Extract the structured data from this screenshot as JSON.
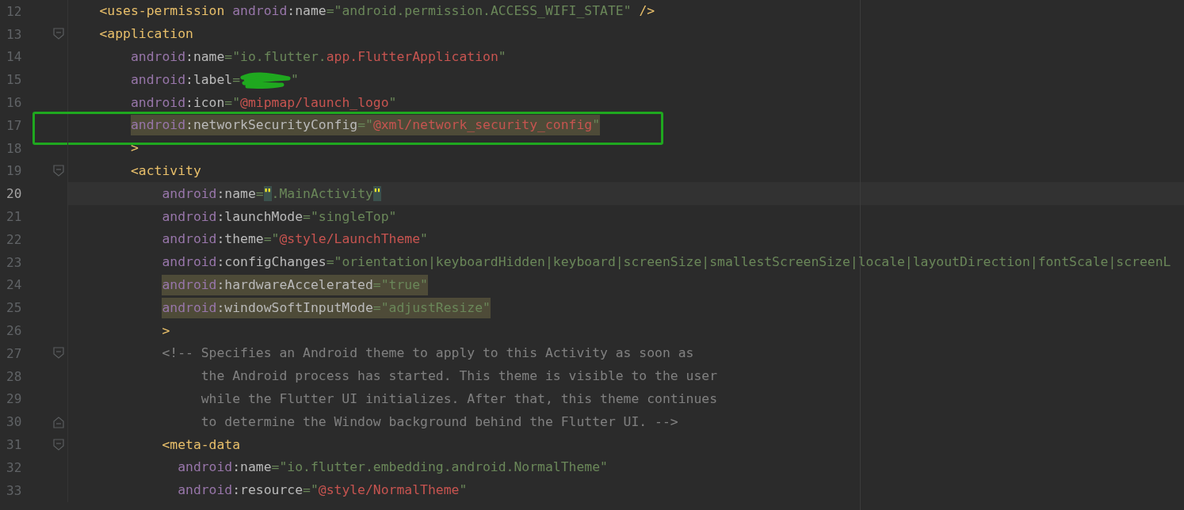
{
  "editor": {
    "lines": [
      {
        "number": "12",
        "tokens": [
          {
            "kind": "tag",
            "text": "<uses-permission"
          },
          {
            "kind": "ns",
            "text": " android"
          },
          {
            "kind": "attr",
            "text": ":name"
          },
          {
            "kind": "string",
            "text": "=\"android.permission.ACCESS_WIFI_STATE\""
          },
          {
            "kind": "tag",
            "text": " />"
          }
        ]
      },
      {
        "number": "13",
        "kind": "block",
        "fold_start": true,
        "tokens": [
          {
            "kind": "tag",
            "text": "<application"
          }
        ],
        "children": [
          {
            "number": "14",
            "tokens": [
              {
                "kind": "ns",
                "text": "android"
              },
              {
                "kind": "attr",
                "text": ":name"
              },
              {
                "kind": "string",
                "text": "=\"io.flutter."
              },
              {
                "kind": "ref",
                "text": "app.FlutterApplication"
              },
              {
                "kind": "string",
                "text": "\""
              }
            ]
          },
          {
            "number": "15",
            "tokens": [
              {
                "kind": "ns",
                "text": "android"
              },
              {
                "kind": "attr",
                "text": ":label"
              },
              {
                "kind": "string",
                "text": "="
              },
              {
                "kind": "scribble"
              },
              {
                "kind": "string",
                "text": "\""
              }
            ]
          },
          {
            "number": "16",
            "tokens": [
              {
                "kind": "ns",
                "text": "android"
              },
              {
                "kind": "attr",
                "text": ":icon"
              },
              {
                "kind": "string",
                "text": "=\""
              },
              {
                "kind": "ref",
                "text": "@mipmap/launch_logo"
              },
              {
                "kind": "string",
                "text": "\""
              }
            ]
          },
          {
            "number": "17",
            "highlighted": true,
            "annotated": true,
            "tokens": [
              {
                "kind": "ns",
                "text": "android"
              },
              {
                "kind": "attr",
                "text": ":networkSecurityConfig"
              },
              {
                "kind": "string",
                "text": "=\""
              },
              {
                "kind": "ref",
                "text": "@xml/network_security_config"
              },
              {
                "kind": "string",
                "text": "\""
              }
            ]
          },
          {
            "number": "18",
            "tokens": [
              {
                "kind": "tag",
                "text": ">"
              }
            ]
          },
          {
            "number": "19",
            "kind": "block",
            "fold_start": true,
            "tokens": [
              {
                "kind": "tag",
                "text": "<activity"
              }
            ],
            "children": [
              {
                "number": "20",
                "current": true,
                "tokens": [
                  {
                    "kind": "ns",
                    "text": "android"
                  },
                  {
                    "kind": "attr",
                    "text": ":name"
                  },
                  {
                    "kind": "string",
                    "text": "="
                  },
                  {
                    "kind": "match",
                    "text": "\""
                  },
                  {
                    "kind": "string",
                    "text": ".MainActivity"
                  },
                  {
                    "kind": "match",
                    "text": "\""
                  }
                ]
              },
              {
                "number": "21",
                "tokens": [
                  {
                    "kind": "ns",
                    "text": "android"
                  },
                  {
                    "kind": "attr",
                    "text": ":launchMode"
                  },
                  {
                    "kind": "string",
                    "text": "=\"singleTop\""
                  }
                ]
              },
              {
                "number": "22",
                "tokens": [
                  {
                    "kind": "ns",
                    "text": "android"
                  },
                  {
                    "kind": "attr",
                    "text": ":theme"
                  },
                  {
                    "kind": "string",
                    "text": "=\""
                  },
                  {
                    "kind": "ref",
                    "text": "@style/LaunchTheme"
                  },
                  {
                    "kind": "string",
                    "text": "\""
                  }
                ]
              },
              {
                "number": "23",
                "tokens": [
                  {
                    "kind": "ns",
                    "text": "android"
                  },
                  {
                    "kind": "attr",
                    "text": ":configChanges"
                  },
                  {
                    "kind": "string",
                    "text": "=\"orientation|keyboardHidden|keyboard|screenSize|smallestScreenSize|locale|layoutDirection|fontScale|screenL"
                  }
                ]
              },
              {
                "number": "24",
                "highlighted": true,
                "tokens": [
                  {
                    "kind": "ns",
                    "text": "android"
                  },
                  {
                    "kind": "attr",
                    "text": ":hardwareAccelerated"
                  },
                  {
                    "kind": "string",
                    "text": "=\"true\""
                  }
                ]
              },
              {
                "number": "25",
                "highlighted": true,
                "tokens": [
                  {
                    "kind": "ns",
                    "text": "android"
                  },
                  {
                    "kind": "attr",
                    "text": ":windowSoftInputMode"
                  },
                  {
                    "kind": "string",
                    "text": "=\"adjustResize\""
                  }
                ]
              },
              {
                "number": "26",
                "tokens": [
                  {
                    "kind": "tag",
                    "text": ">"
                  }
                ]
              },
              {
                "number": "27",
                "kind": "comment",
                "fold_start": true,
                "tokens": [
                  {
                    "kind": "comment",
                    "text": "<!-- Specifies an Android theme to apply to this Activity as soon as"
                  }
                ],
                "children": [
                  {
                    "number": "28",
                    "tokens": [
                      {
                        "kind": "comment",
                        "text": "the Android process has started. This theme is visible to the user"
                      }
                    ]
                  },
                  {
                    "number": "29",
                    "tokens": [
                      {
                        "kind": "comment",
                        "text": "while the Flutter UI initializes. After that, this theme continues"
                      }
                    ]
                  },
                  {
                    "number": "30",
                    "fold_end": true,
                    "tokens": [
                      {
                        "kind": "comment",
                        "text": "to determine the Window background behind the Flutter UI. -->"
                      }
                    ]
                  }
                ]
              },
              {
                "number": "31",
                "kind": "inline",
                "fold_start": true,
                "tokens": [
                  {
                    "kind": "tag",
                    "text": "<meta-data"
                  }
                ],
                "children": [
                  {
                    "number": "32",
                    "tokens": [
                      {
                        "kind": "ns",
                        "text": "android"
                      },
                      {
                        "kind": "attr",
                        "text": ":name"
                      },
                      {
                        "kind": "string",
                        "text": "=\"io.flutter.embedding.android.NormalTheme\""
                      }
                    ]
                  },
                  {
                    "number": "33",
                    "tokens": [
                      {
                        "kind": "ns",
                        "text": "android"
                      },
                      {
                        "kind": "attr",
                        "text": ":resource"
                      },
                      {
                        "kind": "string",
                        "text": "=\""
                      },
                      {
                        "kind": "ref",
                        "text": "@style/NormalTheme"
                      },
                      {
                        "kind": "string",
                        "text": "\""
                      }
                    ]
                  }
                ]
              }
            ]
          }
        ]
      }
    ]
  }
}
